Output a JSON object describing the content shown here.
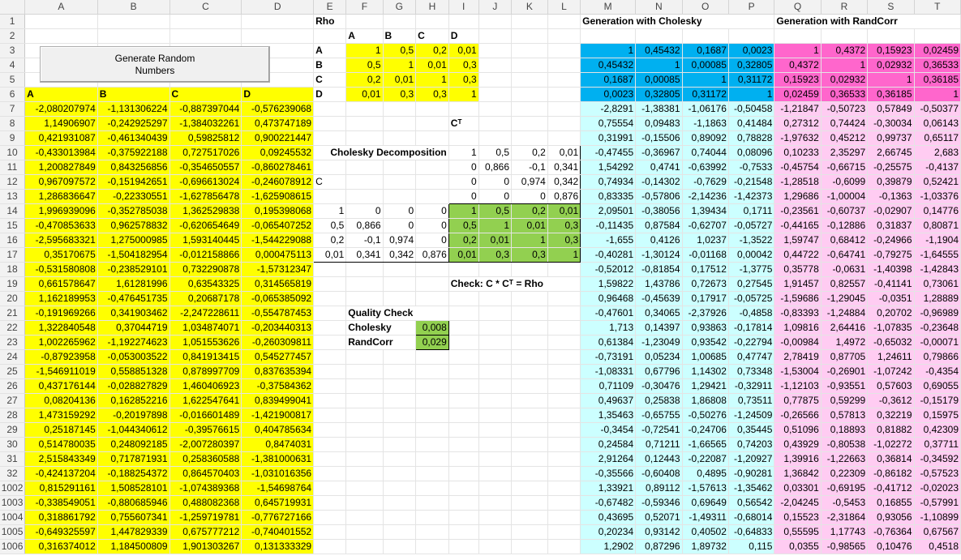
{
  "columns": [
    "A",
    "B",
    "C",
    "D",
    "E",
    "F",
    "G",
    "H",
    "I",
    "J",
    "K",
    "L",
    "M",
    "N",
    "O",
    "P",
    "Q",
    "R",
    "S",
    "T"
  ],
  "button": {
    "label": "Generate Random\nNumbers"
  },
  "rows": [
    {
      "num": "1",
      "cells": [
        "",
        "",
        "",
        "",
        "Rho",
        "",
        "",
        "",
        "",
        "",
        "",
        "",
        "Generation with Cholesky",
        "",
        "",
        "",
        "Generation with RandCorr",
        "",
        "",
        ""
      ]
    },
    {
      "num": "2",
      "cells": [
        "",
        "",
        "",
        "",
        "",
        "A",
        "B",
        "C",
        "D",
        "",
        "",
        "",
        "",
        "",
        "",
        "",
        "",
        "",
        "",
        ""
      ]
    },
    {
      "num": "3",
      "cells": [
        "",
        "",
        "",
        "",
        "A",
        "1",
        "0,5",
        "0,2",
        "0,01",
        "",
        "",
        "",
        "1",
        "0,45432",
        "0,1687",
        "0,0023",
        "1",
        "0,4372",
        "0,15923",
        "0,02459"
      ]
    },
    {
      "num": "4",
      "cells": [
        "",
        "",
        "",
        "",
        "B",
        "0,5",
        "1",
        "0,01",
        "0,3",
        "",
        "",
        "",
        "0,45432",
        "1",
        "0,00085",
        "0,32805",
        "0,4372",
        "1",
        "0,02932",
        "0,36533"
      ]
    },
    {
      "num": "5",
      "cells": [
        "",
        "",
        "",
        "",
        "C",
        "0,2",
        "0,01",
        "1",
        "0,3",
        "",
        "",
        "",
        "0,1687",
        "0,00085",
        "1",
        "0,31172",
        "0,15923",
        "0,02932",
        "1",
        "0,36185"
      ]
    },
    {
      "num": "6",
      "cells": [
        "A",
        "B",
        "C",
        "D",
        "D",
        "0,01",
        "0,3",
        "0,3",
        "1",
        "",
        "",
        "",
        "0,0023",
        "0,32805",
        "0,31172",
        "1",
        "0,02459",
        "0,36533",
        "0,36185",
        "1"
      ]
    },
    {
      "num": "7",
      "cells": [
        "-2,080207974",
        "-1,131306224",
        "-0,887397044",
        "-0,576239068",
        "",
        "",
        "",
        "",
        "",
        "",
        "",
        "",
        "-2,8291",
        "-1,38381",
        "-1,06176",
        "-0,50458",
        "-1,21847",
        "-0,50723",
        "0,57849",
        "-0,50377"
      ]
    },
    {
      "num": "8",
      "cells": [
        "1,14906907",
        "-0,242925297",
        "-1,384032261",
        "0,473747189",
        "",
        "",
        "",
        "",
        "Cᵀ",
        "",
        "",
        "",
        "0,75554",
        "0,09483",
        "-1,1863",
        "0,41484",
        "0,27312",
        "0,74424",
        "-0,30034",
        "0,06143"
      ]
    },
    {
      "num": "9",
      "cells": [
        "0,421931087",
        "-0,461340439",
        "0,59825812",
        "0,900221447",
        "",
        "",
        "",
        "",
        "",
        "",
        "",
        "",
        "0,31991",
        "-0,15506",
        "0,89092",
        "0,78828",
        "-1,97632",
        "0,45212",
        "0,99737",
        "0,65117"
      ]
    },
    {
      "num": "10",
      "cells": [
        "-0,433013984",
        "-0,375922188",
        "0,727517026",
        "0,09245532",
        "Cholesky Decomposition",
        "",
        "",
        "",
        "1",
        "0,5",
        "0,2",
        "0,01",
        "-0,47455",
        "-0,36967",
        "0,74044",
        "0,08096",
        "0,10233",
        "2,35297",
        "2,66745",
        "2,683"
      ]
    },
    {
      "num": "11",
      "cells": [
        "1,200827849",
        "0,843256856",
        "-0,354650557",
        "-0,860278461",
        "",
        "",
        "",
        "",
        "0",
        "0,866",
        "-0,1",
        "0,341",
        "1,54292",
        "0,4741",
        "-0,63992",
        "-0,7533",
        "-0,45754",
        "-0,66715",
        "-0,25575",
        "-0,4137"
      ]
    },
    {
      "num": "12",
      "cells": [
        "0,967097572",
        "-0,151942651",
        "-0,696613024",
        "-0,246078912",
        "C",
        "",
        "",
        "",
        "0",
        "0",
        "0,974",
        "0,342",
        "0,74934",
        "-0,14302",
        "-0,7629",
        "-0,21548",
        "-1,28518",
        "-0,6099",
        "0,39879",
        "0,52421"
      ]
    },
    {
      "num": "13",
      "cells": [
        "1,286836647",
        "-0,22330551",
        "-1,627856478",
        "-1,625908615",
        "",
        "",
        "",
        "",
        "0",
        "0",
        "0",
        "0,876",
        "0,83335",
        "-0,57806",
        "-2,14236",
        "-1,42373",
        "1,29686",
        "-1,00004",
        "-0,1363",
        "-1,03376"
      ]
    },
    {
      "num": "14",
      "cells": [
        "1,996939096",
        "-0,352785038",
        "1,362529838",
        "0,195398068",
        "1",
        "0",
        "0",
        "0",
        "1",
        "0,5",
        "0,2",
        "0,01",
        "2,09501",
        "-0,38056",
        "1,39434",
        "0,1711",
        "-0,23561",
        "-0,60737",
        "-0,02907",
        "0,14776"
      ]
    },
    {
      "num": "15",
      "cells": [
        "-0,470853633",
        "0,962578832",
        "-0,620654649",
        "-0,065407252",
        "0,5",
        "0,866",
        "0",
        "0",
        "0,5",
        "1",
        "0,01",
        "0,3",
        "-0,11435",
        "0,87584",
        "-0,62707",
        "-0,05727",
        "-0,44165",
        "-0,12886",
        "0,31837",
        "0,80871"
      ]
    },
    {
      "num": "16",
      "cells": [
        "-2,595683321",
        "1,275000985",
        "1,593140445",
        "-1,544229088",
        "0,2",
        "-0,1",
        "0,974",
        "0",
        "0,2",
        "0,01",
        "1",
        "0,3",
        "-1,655",
        "0,4126",
        "1,0237",
        "-1,3522",
        "1,59747",
        "0,68412",
        "-0,24966",
        "-1,1904"
      ]
    },
    {
      "num": "17",
      "cells": [
        "0,35170675",
        "-1,504182954",
        "-0,012158866",
        "0,000475113",
        "0,01",
        "0,341",
        "0,342",
        "0,876",
        "0,01",
        "0,3",
        "0,3",
        "1",
        "-0,40281",
        "-1,30124",
        "-0,01168",
        "0,00042",
        "0,44722",
        "-0,64741",
        "-0,79275",
        "-1,64555"
      ]
    },
    {
      "num": "18",
      "cells": [
        "-0,531580808",
        "-0,238529101",
        "0,732290878",
        "-1,57312347",
        "",
        "",
        "",
        "",
        "",
        "",
        "",
        "",
        "-0,52012",
        "-0,81854",
        "0,17512",
        "-1,3775",
        "0,35778",
        "-0,0631",
        "-1,40398",
        "-1,42843"
      ]
    },
    {
      "num": "19",
      "cells": [
        "0,661578647",
        "1,61281996",
        "0,63543325",
        "0,314565819",
        "",
        "",
        "",
        "",
        "Check: C * Cᵀ = Rho",
        "",
        "",
        "",
        "1,59822",
        "1,43786",
        "0,72673",
        "0,27545",
        "1,91457",
        "0,82557",
        "-0,41141",
        "0,73061"
      ]
    },
    {
      "num": "20",
      "cells": [
        "1,162189953",
        "-0,476451735",
        "0,20687178",
        "-0,065385092",
        "",
        "",
        "",
        "",
        "",
        "",
        "",
        "",
        "0,96468",
        "-0,45639",
        "0,17917",
        "-0,05725",
        "-1,59686",
        "-1,29045",
        "-0,0351",
        "1,28889"
      ]
    },
    {
      "num": "21",
      "cells": [
        "-0,191969266",
        "0,341903462",
        "-2,247228611",
        "-0,554787453",
        "",
        "Quality Check",
        "",
        "",
        "",
        "",
        "",
        "",
        "-0,47601",
        "0,34065",
        "-2,37926",
        "-0,4858",
        "-0,83393",
        "-1,24884",
        "0,20702",
        "-0,96989"
      ]
    },
    {
      "num": "22",
      "cells": [
        "1,322840548",
        "0,37044719",
        "1,034874071",
        "-0,203440313",
        "",
        "Cholesky",
        "",
        "0,008",
        "",
        "",
        "",
        "",
        "1,713",
        "0,14397",
        "0,93863",
        "-0,17814",
        "1,09816",
        "2,64416",
        "-1,07835",
        "-0,23648"
      ]
    },
    {
      "num": "23",
      "cells": [
        "1,002265962",
        "-1,192274623",
        "1,051553626",
        "-0,260309811",
        "",
        "RandCorr",
        "",
        "0,029",
        "",
        "",
        "",
        "",
        "0,61384",
        "-1,23049",
        "0,93542",
        "-0,22794",
        "-0,00984",
        "1,4972",
        "-0,65032",
        "-0,00071"
      ]
    },
    {
      "num": "24",
      "cells": [
        "-0,87923958",
        "-0,053003522",
        "0,841913415",
        "0,545277457",
        "",
        "",
        "",
        "",
        "",
        "",
        "",
        "",
        "-0,73191",
        "0,05234",
        "1,00685",
        "0,47747",
        "2,78419",
        "0,87705",
        "1,24611",
        "0,79866"
      ]
    },
    {
      "num": "25",
      "cells": [
        "-1,546911019",
        "0,558851328",
        "0,878997709",
        "0,837635394",
        "",
        "",
        "",
        "",
        "",
        "",
        "",
        "",
        "-1,08331",
        "0,67796",
        "1,14302",
        "0,73348",
        "-1,53004",
        "-0,26901",
        "-1,07242",
        "-0,4354"
      ]
    },
    {
      "num": "26",
      "cells": [
        "0,437176144",
        "-0,028827829",
        "1,460406923",
        "-0,37584362",
        "",
        "",
        "",
        "",
        "",
        "",
        "",
        "",
        "0,71109",
        "-0,30476",
        "1,29421",
        "-0,32911",
        "-1,12103",
        "-0,93551",
        "0,57603",
        "0,69055"
      ]
    },
    {
      "num": "27",
      "cells": [
        "0,08204136",
        "0,162852216",
        "1,622547641",
        "0,839499041",
        "",
        "",
        "",
        "",
        "",
        "",
        "",
        "",
        "0,49637",
        "0,25838",
        "1,86808",
        "0,73511",
        "0,77875",
        "0,59299",
        "-0,3612",
        "-0,15179"
      ]
    },
    {
      "num": "28",
      "cells": [
        "1,473159292",
        "-0,20197898",
        "-0,016601489",
        "-1,421900817",
        "",
        "",
        "",
        "",
        "",
        "",
        "",
        "",
        "1,35463",
        "-0,65755",
        "-0,50276",
        "-1,24509",
        "-0,26566",
        "0,57813",
        "0,32219",
        "0,15975"
      ]
    },
    {
      "num": "29",
      "cells": [
        "0,25187145",
        "-1,044340612",
        "-0,39576615",
        "0,404785634",
        "",
        "",
        "",
        "",
        "",
        "",
        "",
        "",
        "-0,3454",
        "-0,72541",
        "-0,24706",
        "0,35445",
        "0,51096",
        "0,18893",
        "0,81882",
        "0,42309"
      ]
    },
    {
      "num": "30",
      "cells": [
        "0,514780035",
        "0,248092185",
        "-2,007280397",
        "0,8474031",
        "",
        "",
        "",
        "",
        "",
        "",
        "",
        "",
        "0,24584",
        "0,71211",
        "-1,66565",
        "0,74203",
        "0,43929",
        "-0,80538",
        "-1,02272",
        "0,37711"
      ]
    },
    {
      "num": "31",
      "cells": [
        "2,515843349",
        "0,717871931",
        "0,258360588",
        "-1,381000631",
        "",
        "",
        "",
        "",
        "",
        "",
        "",
        "",
        "2,91264",
        "0,12443",
        "-0,22087",
        "-1,20927",
        "1,39916",
        "-1,22663",
        "0,36814",
        "-0,34592"
      ]
    },
    {
      "num": "32",
      "cells": [
        "-0,424137204",
        "-0,188254372",
        "0,864570403",
        "-1,031016356",
        "",
        "",
        "",
        "",
        "",
        "",
        "",
        "",
        "-0,35566",
        "-0,60408",
        "0,4895",
        "-0,90281",
        "1,36842",
        "0,22309",
        "-0,86182",
        "-0,57523"
      ]
    },
    {
      "num": "1002",
      "cells": [
        "0,815291161",
        "1,508528101",
        "-1,074389368",
        "-1,54698764",
        "",
        "",
        "",
        "",
        "",
        "",
        "",
        "",
        "1,33921",
        "0,89112",
        "-1,57613",
        "-1,35462",
        "0,03301",
        "-0,69195",
        "-0,41712",
        "-0,02023"
      ]
    },
    {
      "num": "1003",
      "cells": [
        "-0,338549051",
        "-0,880685946",
        "0,488082368",
        "0,645719931",
        "",
        "",
        "",
        "",
        "",
        "",
        "",
        "",
        "-0,67482",
        "-0,59346",
        "0,69649",
        "0,56542",
        "-2,04245",
        "-0,5453",
        "0,16855",
        "-0,57991"
      ]
    },
    {
      "num": "1004",
      "cells": [
        "0,318861792",
        "0,755607341",
        "-1,259719781",
        "-0,776727166",
        "",
        "",
        "",
        "",
        "",
        "",
        "",
        "",
        "0,43695",
        "0,52071",
        "-1,49311",
        "-0,68014",
        "0,15523",
        "-2,31864",
        "0,93056",
        "-1,10899"
      ]
    },
    {
      "num": "1005",
      "cells": [
        "-0,649325597",
        "1,447829339",
        "0,675777212",
        "-0,740401552",
        "",
        "",
        "",
        "",
        "",
        "",
        "",
        "",
        "0,20234",
        "0,93142",
        "0,40502",
        "-0,64833",
        "0,55595",
        "1,17743",
        "-0,76364",
        "0,67567"
      ]
    },
    {
      "num": "1006",
      "cells": [
        "0,316374012",
        "1,184500809",
        "1,901303267",
        "0,131333329",
        "",
        "",
        "",
        "",
        "",
        "",
        "",
        "",
        "1,2902",
        "0,87296",
        "1,89732",
        "0,115",
        "0,0355",
        "-0,98565",
        "0,10476",
        "0,4518"
      ]
    }
  ]
}
